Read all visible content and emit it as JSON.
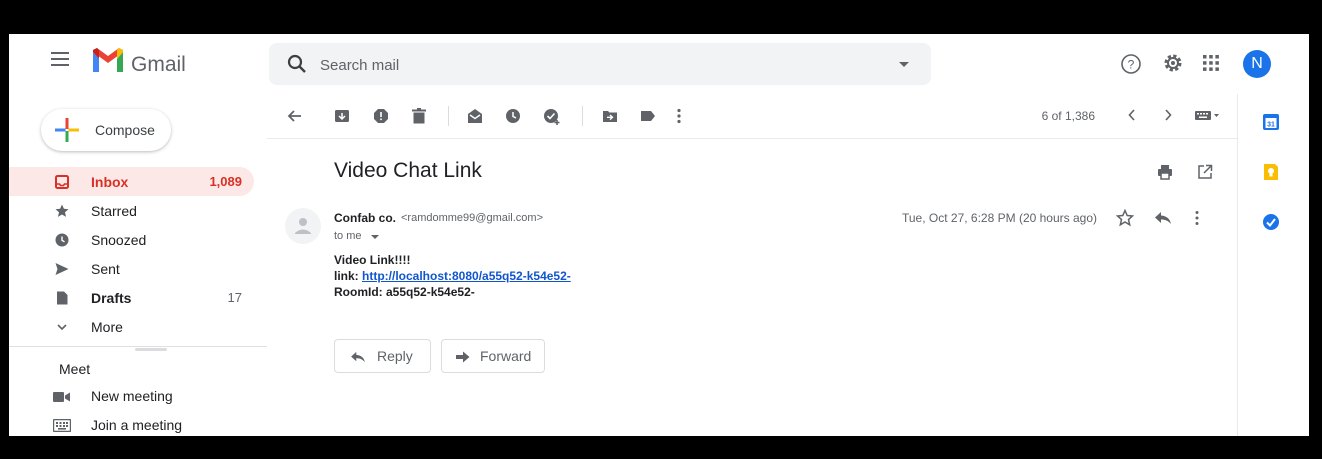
{
  "header": {
    "app_name": "Gmail",
    "search_placeholder": "Search mail",
    "avatar_letter": "N"
  },
  "sidebar": {
    "compose_label": "Compose",
    "items": [
      {
        "label": "Inbox",
        "count": "1,089",
        "icon": "inbox-icon",
        "active": true
      },
      {
        "label": "Starred",
        "count": "",
        "icon": "star-icon"
      },
      {
        "label": "Snoozed",
        "count": "",
        "icon": "clock-icon"
      },
      {
        "label": "Sent",
        "count": "",
        "icon": "send-icon"
      },
      {
        "label": "Drafts",
        "count": "17",
        "icon": "draft-icon"
      },
      {
        "label": "More",
        "count": "",
        "icon": "chevron-down-icon"
      }
    ],
    "meet": {
      "title": "Meet",
      "items": [
        {
          "label": "New meeting",
          "icon": "video-icon"
        },
        {
          "label": "Join a meeting",
          "icon": "keyboard-icon"
        }
      ]
    }
  },
  "toolbar": {
    "pager": "6 of 1,386"
  },
  "message": {
    "subject": "Video Chat Link",
    "sender_name": "Confab co.",
    "sender_email": "<ramdomme99@gmail.com>",
    "to": "to me",
    "date": "Tue, Oct 27, 6:28 PM (20 hours ago)",
    "body": {
      "line1": "Video Link!!!!",
      "link_label": "link:",
      "link_url": "http://localhost:8080/a55q52-k54e52-",
      "room_label": "RoomId:",
      "room_id": "a55q52-k54e52-"
    },
    "reply_label": "Reply",
    "forward_label": "Forward"
  },
  "colors": {
    "accent_red": "#d93025",
    "link_blue": "#1155cc",
    "avatar_blue": "#1a73e8"
  }
}
